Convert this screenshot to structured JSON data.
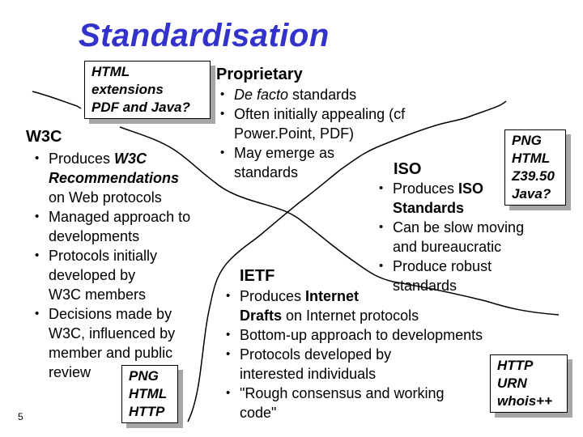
{
  "slide": {
    "title": "Standardisation",
    "slide_number": "5",
    "title_color": "#3333cc",
    "shadow_color": "#a6a6a6"
  },
  "proprietary": {
    "heading": "Proprietary",
    "bullets": [
      {
        "italic": "De facto",
        "rest": " standards"
      },
      {
        "line1": "Often initially appealing (cf",
        "line2": "Power.Point, PDF)"
      },
      {
        "line1": "May emerge as",
        "line2": "standards"
      }
    ],
    "box": [
      "HTML",
      "extensions",
      "PDF and Java?"
    ]
  },
  "w3c": {
    "heading": "W3C",
    "bullets": [
      {
        "pre": "Produces ",
        "emph1": "W3C",
        "emph2": "Recommendations",
        "line3": "on Web protocols"
      },
      {
        "line1": "Managed approach to",
        "line2": "developments"
      },
      {
        "line1": "Protocols initially",
        "line2": "developed by",
        "line3": "W3C members"
      },
      {
        "line1": "Decisions made by",
        "line2": "W3C, influenced by",
        "line3": "member and public",
        "line4": "review"
      }
    ],
    "box": [
      "PNG",
      "HTML",
      "HTTP"
    ]
  },
  "iso": {
    "heading": "ISO",
    "bullets": [
      {
        "pre": "Produces ",
        "bold1": "ISO",
        "bold2": "Standards"
      },
      {
        "line1": "Can be slow moving",
        "line2": "and bureaucratic"
      },
      {
        "line1": "Produce robust",
        "line2": "standards"
      }
    ],
    "box": [
      "PNG",
      "HTML",
      "Z39.50",
      "Java?"
    ]
  },
  "ietf": {
    "heading": "IETF",
    "bullets": [
      {
        "pre": "Produces ",
        "bold1": "Internet",
        "bold2": "Drafts",
        "rest2": " on Internet protocols"
      },
      {
        "line1": "Bottom-up approach to developments"
      },
      {
        "line1": "Protocols developed by",
        "line2": "interested individuals"
      },
      {
        "line1": "\"Rough consensus and working",
        "line2": "code\""
      }
    ],
    "box": [
      "HTTP",
      "URN",
      "whois++"
    ]
  }
}
